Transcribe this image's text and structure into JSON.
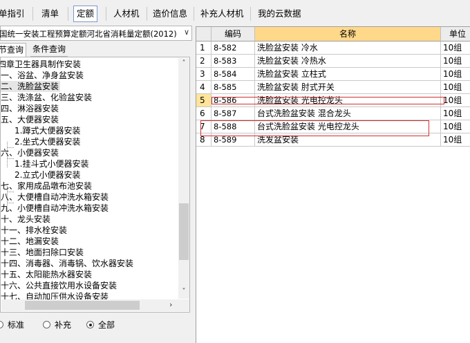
{
  "toolbar": {
    "items": [
      {
        "label": "单指引",
        "active": false
      },
      {
        "label": "清单",
        "active": false
      },
      {
        "label": "定额",
        "active": true
      },
      {
        "label": "人材机",
        "active": false
      },
      {
        "label": "造价信息",
        "active": false
      },
      {
        "label": "补充人材机",
        "active": false
      },
      {
        "label": "我的云数据",
        "active": false
      }
    ]
  },
  "left_panel": {
    "library_select": "国统一安装工程预算定额河北省消耗量定额(2012)",
    "tabs": [
      {
        "label": "节查询",
        "active": true
      },
      {
        "label": "条件查询",
        "active": false
      }
    ],
    "tree": [
      {
        "label": "四章卫生器具制作安装",
        "level": 0
      },
      {
        "label": "一、浴盆、净身盆安装",
        "level": 0
      },
      {
        "label": "二、洗脸盆安装",
        "level": 0,
        "selected": true
      },
      {
        "label": "三、洗涤盆、化验盆安装",
        "level": 0
      },
      {
        "label": "四、淋浴器安装",
        "level": 0
      },
      {
        "label": "五、大便器安装",
        "level": 0
      },
      {
        "label": "1.蹲式大便器安装",
        "level": 1
      },
      {
        "label": "2.坐式大便器安装",
        "level": 1
      },
      {
        "label": "六、小便器安装",
        "level": 0
      },
      {
        "label": "1.挂斗式小便器安装",
        "level": 1
      },
      {
        "label": "2.立式小便器安装",
        "level": 1
      },
      {
        "label": "七、家用成品墩布池安装",
        "level": 0
      },
      {
        "label": "八、大便槽自动冲洗水箱安装",
        "level": 0
      },
      {
        "label": "九、小便槽自动冲洗水箱安装",
        "level": 0
      },
      {
        "label": "十、龙头安装",
        "level": 0
      },
      {
        "label": "十一、排水栓安装",
        "level": 0
      },
      {
        "label": "十二、地漏安装",
        "level": 0
      },
      {
        "label": "十三、地面扫除口安装",
        "level": 0
      },
      {
        "label": "十四、消毒器、消毒锅、饮水器安装",
        "level": 0
      },
      {
        "label": "十五、太阳能热水器安装",
        "level": 0
      },
      {
        "label": "十六、公共直接饮用水设备安装",
        "level": 0
      },
      {
        "label": "十七、自动加压供水设备安装",
        "level": 0
      }
    ],
    "filter": {
      "options": [
        {
          "label": "标准",
          "checked": false
        },
        {
          "label": "补充",
          "checked": false
        },
        {
          "label": "全部",
          "checked": true
        }
      ]
    }
  },
  "grid": {
    "columns": [
      "",
      "编码",
      "名称",
      "单位"
    ],
    "rows": [
      {
        "no": "1",
        "code": "8-582",
        "name": "洗脸盆安装 冷水",
        "unit": "10组"
      },
      {
        "no": "2",
        "code": "8-583",
        "name": "洗脸盆安装 冷热水",
        "unit": "10组"
      },
      {
        "no": "3",
        "code": "8-584",
        "name": "洗脸盆安装 立柱式",
        "unit": "10组"
      },
      {
        "no": "4",
        "code": "8-585",
        "name": "洗脸盆安装 肘式开关",
        "unit": "10组"
      },
      {
        "no": "5",
        "code": "8-586",
        "name": "洗脸盆安装 光电控龙头",
        "unit": "10组",
        "current": true
      },
      {
        "no": "6",
        "code": "8-587",
        "name": "台式洗脸盆安装 混合龙头",
        "unit": "10组"
      },
      {
        "no": "7",
        "code": "8-588",
        "name": "台式洗脸盆安装 光电控龙头",
        "unit": "10组"
      },
      {
        "no": "8",
        "code": "8-589",
        "name": "洗发盆安装",
        "unit": "10组"
      }
    ]
  },
  "colors": {
    "header_highlight": "#ffd88a",
    "current_row_marker": "#ffe49a",
    "annotation_box": "#d03030"
  }
}
